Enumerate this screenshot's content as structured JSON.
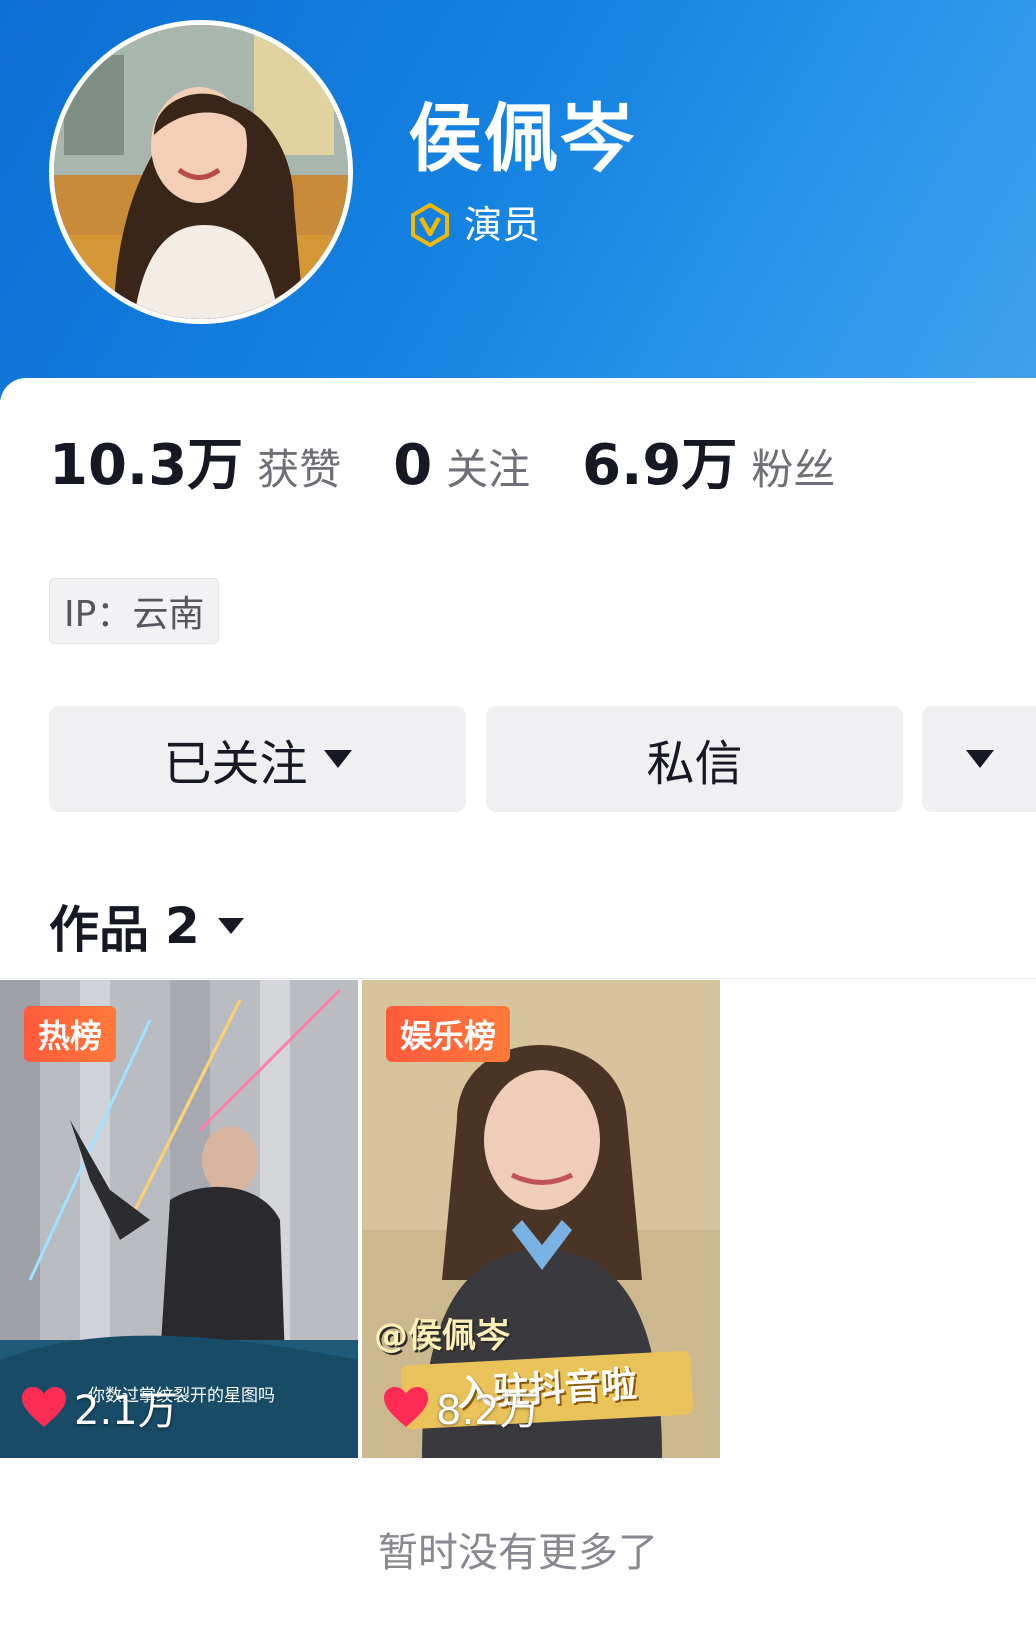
{
  "profile": {
    "name": "侯佩岑",
    "verification_label": "演员",
    "verification_icon": "verified-v-badge-icon",
    "accent_gold": "#f5b800",
    "header_color": "#1481e0"
  },
  "stats": [
    {
      "number": "10.3万",
      "label": "获赞"
    },
    {
      "number": "0",
      "label": "关注"
    },
    {
      "number": "6.9万",
      "label": "粉丝"
    }
  ],
  "ip": {
    "text": "IP：云南"
  },
  "actions": {
    "follow_label": "已关注",
    "message_label": "私信",
    "more_icon": "caret-down-icon"
  },
  "works": {
    "title": "作品",
    "count": "2",
    "items": [
      {
        "badge": "热榜",
        "likes": "2.1万",
        "caption": "你数过掌纹裂开的星图吗"
      },
      {
        "badge": "娱乐榜",
        "likes": "8.2万",
        "mention": "@侯佩岑",
        "banner": "入驻抖音啦"
      }
    ]
  },
  "footer": {
    "text": "暂时没有更多了"
  }
}
